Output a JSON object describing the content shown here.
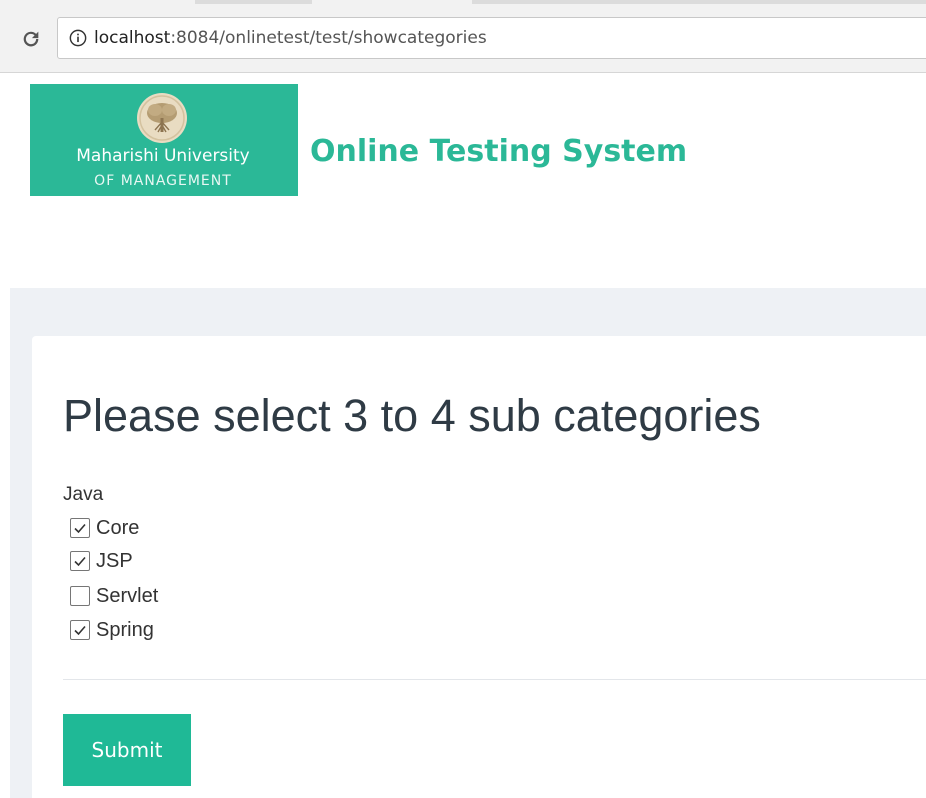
{
  "browser": {
    "url_host": "localhost",
    "url_rest": ":8084/onlinetest/test/showcategories"
  },
  "header": {
    "logo_line1": "Maharishi University",
    "logo_line2": "OF MANAGEMENT",
    "site_title": "Online Testing System"
  },
  "form": {
    "heading": "Please select 3 to 4 sub categories",
    "category": "Java",
    "options": [
      {
        "label": "Core",
        "checked": true
      },
      {
        "label": "JSP",
        "checked": true
      },
      {
        "label": "Servlet",
        "checked": false
      },
      {
        "label": "Spring",
        "checked": true
      }
    ],
    "submit_label": "Submit"
  },
  "colors": {
    "brand": "#2bb897",
    "button": "#1fb996",
    "page_bg": "#eef1f5"
  }
}
